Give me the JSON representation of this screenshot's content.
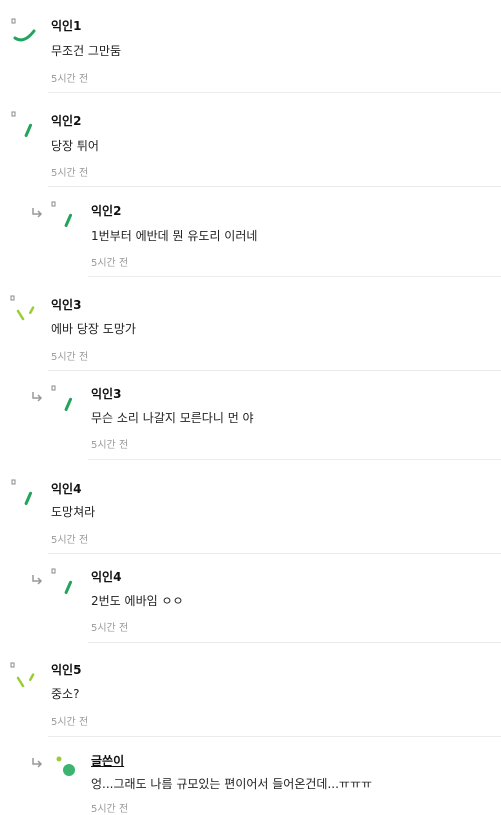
{
  "comments": [
    {
      "name": "익인1",
      "text": "무조건 그만둠",
      "time": "5시간 전",
      "reply": false,
      "avatar": "icon-a"
    },
    {
      "name": "익인2",
      "text": "당장 튀어",
      "time": "5시간 전",
      "reply": false,
      "avatar": "icon-b"
    },
    {
      "name": "익인2",
      "text": "1번부터 에반데 뭔 유도리 이러네",
      "time": "5시간 전",
      "reply": true,
      "avatar": "icon-b"
    },
    {
      "name": "익인3",
      "text": "에바 당장 도망가",
      "time": "5시간 전",
      "reply": false,
      "avatar": "icon-c"
    },
    {
      "name": "익인3",
      "text": "무슨 소리 나갈지 모른다니 먼 야",
      "time": "5시간 전",
      "reply": true,
      "avatar": "icon-b"
    },
    {
      "name": "익인4",
      "text": "도망쳐라",
      "time": "5시간 전",
      "reply": false,
      "avatar": "icon-b"
    },
    {
      "name": "익인4",
      "text": "2번도 에바임 ㅇㅇ",
      "time": "5시간 전",
      "reply": true,
      "avatar": "icon-b"
    },
    {
      "name": "익인5",
      "text": "중소?",
      "time": "5시간 전",
      "reply": false,
      "avatar": "icon-c"
    },
    {
      "name": "글쓴이",
      "text": "엉...그래도 나름 규모있는 편이어서 들어온건데...ㅠㅠㅠ",
      "time": "5시간 전",
      "reply": true,
      "avatar": "icon-d"
    }
  ],
  "colors": {
    "green": "#22a45d",
    "lime": "#9acd32",
    "time": "#9a9a9a"
  }
}
